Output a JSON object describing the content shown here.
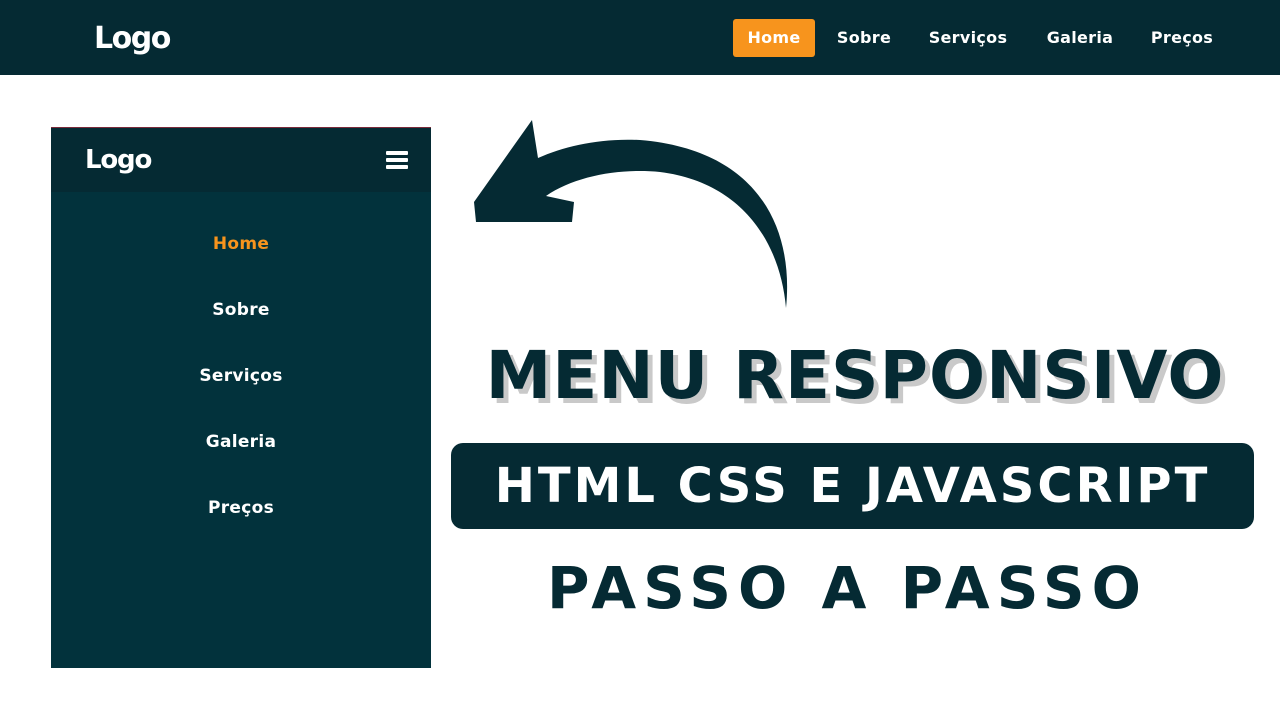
{
  "top_nav": {
    "logo": "Logo",
    "items": [
      {
        "label": "Home",
        "active": true
      },
      {
        "label": "Sobre",
        "active": false
      },
      {
        "label": "Serviços",
        "active": false
      },
      {
        "label": "Galeria",
        "active": false
      },
      {
        "label": "Preços",
        "active": false
      }
    ]
  },
  "mobile_menu": {
    "logo": "Logo",
    "menu_icon": "hamburger-icon",
    "items": [
      {
        "label": "Home",
        "active": true
      },
      {
        "label": "Sobre",
        "active": false
      },
      {
        "label": "Serviços",
        "active": false
      },
      {
        "label": "Galeria",
        "active": false
      },
      {
        "label": "Preços",
        "active": false
      }
    ]
  },
  "headline": {
    "line1": "MENU RESPONSIVO",
    "line2": "HTML CSS E JAVASCRIPT",
    "line3": "PASSO A PASSO"
  },
  "decoration": {
    "arrow_icon": "curved-arrow-left-icon"
  },
  "colors": {
    "primary_dark": "#052a33",
    "menu_panel": "#02323c",
    "accent": "#f7941d",
    "text_light": "#ffffff"
  }
}
